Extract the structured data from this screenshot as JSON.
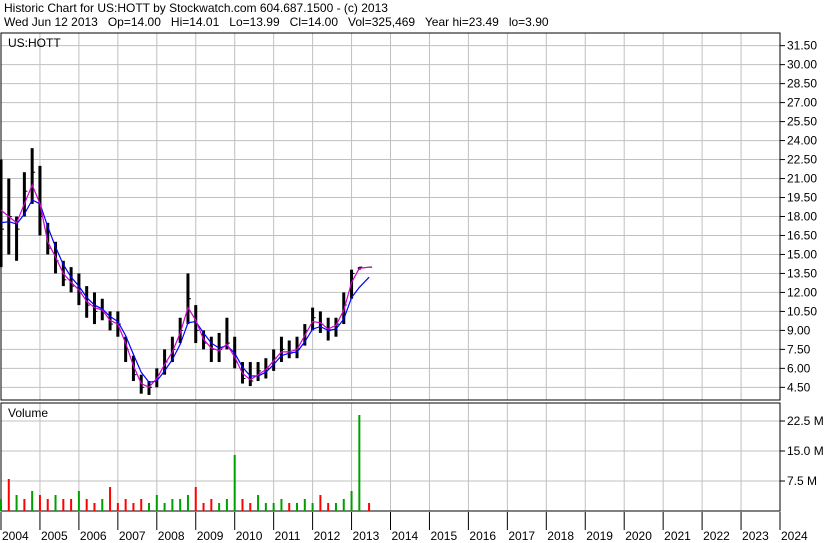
{
  "header": {
    "line1": "Historic Chart for US:HOTT by Stockwatch.com 604.687.1500 - (c) 2013",
    "line2": "Wed Jun 12 2013   Op=14.00   Hi=14.01   Lo=13.99   Cl=14.00   Vol=325,469   Year hi=23.49   lo=3.90"
  },
  "colors": {
    "price_bars": "#000000",
    "ma_short": "#d000d0",
    "ma_long": "#0000ff",
    "volume_up": "#00a000",
    "volume_down": "#ff0000",
    "grid": "#c0c0c0"
  },
  "chart_data": [
    {
      "type": "line",
      "panel_label": "US:HOTT",
      "ylim": [
        3.5,
        32.5
      ],
      "y_ticks": [
        "31.50",
        "30.00",
        "28.50",
        "27.00",
        "25.50",
        "24.00",
        "22.50",
        "21.00",
        "19.50",
        "18.00",
        "16.50",
        "15.00",
        "13.50",
        "12.00",
        "10.50",
        "9.00",
        "7.50",
        "6.00",
        "4.50"
      ],
      "y_tick_values": [
        31.5,
        30,
        28.5,
        27,
        25.5,
        24,
        22.5,
        21,
        19.5,
        18,
        16.5,
        15,
        13.5,
        12,
        10.5,
        9,
        7.5,
        6,
        4.5
      ],
      "x": [
        2004.0,
        2004.2,
        2004.4,
        2004.6,
        2004.8,
        2005.0,
        2005.2,
        2005.4,
        2005.6,
        2005.8,
        2006.0,
        2006.2,
        2006.4,
        2006.6,
        2006.8,
        2007.0,
        2007.2,
        2007.4,
        2007.6,
        2007.8,
        2008.0,
        2008.2,
        2008.4,
        2008.6,
        2008.8,
        2009.0,
        2009.2,
        2009.4,
        2009.6,
        2009.8,
        2010.0,
        2010.2,
        2010.4,
        2010.6,
        2010.8,
        2011.0,
        2011.2,
        2011.4,
        2011.6,
        2011.8,
        2012.0,
        2012.2,
        2012.4,
        2012.6,
        2012.8,
        2013.0,
        2013.2,
        2013.45
      ],
      "high": [
        22.5,
        21.0,
        18.0,
        21.5,
        23.4,
        22.0,
        17.5,
        16.0,
        14.5,
        14.0,
        13.5,
        12.5,
        12.0,
        11.5,
        10.5,
        10.5,
        8.5,
        7.0,
        5.5,
        5.0,
        6.0,
        7.5,
        8.5,
        10.0,
        13.5,
        11.0,
        9.0,
        8.5,
        8.8,
        10.0,
        8.5,
        6.5,
        6.5,
        6.5,
        6.8,
        7.5,
        8.5,
        8.2,
        8.5,
        9.5,
        10.8,
        10.5,
        10.0,
        10.0,
        12.0,
        13.8,
        14.0,
        14.0
      ],
      "low": [
        14.0,
        15.0,
        14.5,
        18.0,
        19.0,
        16.5,
        15.0,
        13.5,
        12.5,
        12.0,
        11.0,
        10.0,
        9.5,
        9.8,
        9.0,
        8.5,
        6.5,
        5.0,
        4.0,
        3.9,
        4.5,
        5.5,
        6.5,
        8.0,
        9.5,
        8.0,
        7.5,
        6.5,
        6.5,
        7.5,
        6.0,
        4.8,
        4.6,
        5.0,
        5.2,
        5.8,
        6.5,
        6.8,
        6.8,
        7.8,
        9.0,
        8.8,
        8.2,
        8.5,
        9.5,
        11.5,
        13.8,
        13.99
      ],
      "close": [
        17.0,
        18.0,
        17.0,
        20.0,
        21.5,
        18.0,
        15.5,
        14.5,
        13.0,
        12.5,
        12.0,
        11.0,
        10.5,
        10.5,
        9.5,
        9.5,
        7.5,
        5.5,
        4.5,
        4.5,
        5.5,
        6.5,
        7.5,
        9.0,
        11.5,
        9.0,
        8.0,
        7.5,
        7.5,
        8.0,
        6.5,
        5.2,
        5.0,
        5.8,
        6.0,
        6.8,
        7.5,
        7.2,
        7.5,
        9.0,
        10.0,
        9.5,
        9.0,
        9.5,
        11.0,
        13.5,
        14.0,
        14.0
      ],
      "ma_short": [
        18.5,
        18.0,
        17.5,
        19.0,
        20.5,
        19.0,
        16.0,
        14.8,
        13.5,
        12.8,
        12.2,
        11.3,
        10.8,
        10.6,
        9.8,
        9.5,
        8.0,
        6.2,
        4.8,
        4.5,
        5.2,
        6.3,
        7.3,
        8.8,
        10.8,
        9.8,
        8.3,
        7.6,
        7.4,
        7.9,
        6.9,
        5.6,
        5.1,
        5.5,
        5.9,
        6.6,
        7.3,
        7.3,
        7.5,
        8.6,
        9.7,
        9.6,
        9.1,
        9.4,
        10.6,
        12.8,
        13.9,
        14.0
      ],
      "ma_long": [
        17.5,
        17.6,
        17.4,
        18.2,
        19.3,
        19.0,
        17.2,
        15.6,
        14.2,
        13.2,
        12.5,
        11.6,
        11.0,
        10.7,
        10.1,
        9.7,
        8.6,
        7.1,
        5.7,
        4.9,
        5.0,
        5.8,
        6.7,
        7.9,
        9.6,
        9.7,
        8.8,
        8.0,
        7.6,
        7.8,
        7.2,
        6.1,
        5.4,
        5.4,
        5.7,
        6.3,
        7.0,
        7.2,
        7.3,
        8.1,
        9.1,
        9.3,
        9.0,
        9.1,
        9.9,
        11.6,
        12.4,
        13.2
      ]
    },
    {
      "type": "bar",
      "panel_label": "Volume",
      "ylim": [
        0,
        27
      ],
      "y_ticks": [
        "22.5 M",
        "15.0 M",
        "7.5 M"
      ],
      "y_tick_values": [
        22.5,
        15.0,
        7.5
      ],
      "x": [
        2004.0,
        2004.2,
        2004.4,
        2004.6,
        2004.8,
        2005.0,
        2005.2,
        2005.4,
        2005.6,
        2005.8,
        2006.0,
        2006.2,
        2006.4,
        2006.6,
        2006.8,
        2007.0,
        2007.2,
        2007.4,
        2007.6,
        2007.8,
        2008.0,
        2008.2,
        2008.4,
        2008.6,
        2008.8,
        2009.0,
        2009.2,
        2009.4,
        2009.6,
        2009.8,
        2010.0,
        2010.2,
        2010.4,
        2010.6,
        2010.8,
        2011.0,
        2011.2,
        2011.4,
        2011.6,
        2011.8,
        2012.0,
        2012.2,
        2012.4,
        2012.6,
        2012.8,
        2013.0,
        2013.2,
        2013.45
      ],
      "values": [
        3,
        8,
        4,
        3,
        5,
        4,
        3,
        4,
        3,
        3,
        5,
        3,
        2,
        3,
        6,
        2,
        3,
        2,
        3,
        2,
        4,
        2,
        3,
        3,
        4,
        6,
        2,
        3,
        2,
        3,
        14,
        3,
        2,
        4,
        2,
        2,
        3,
        2,
        2,
        3,
        2,
        4,
        2,
        2,
        3,
        5,
        24,
        2
      ],
      "up": [
        true,
        false,
        true,
        false,
        true,
        false,
        false,
        true,
        false,
        false,
        true,
        false,
        false,
        true,
        false,
        false,
        false,
        false,
        false,
        true,
        true,
        true,
        true,
        true,
        true,
        false,
        false,
        false,
        true,
        true,
        true,
        false,
        false,
        true,
        true,
        true,
        true,
        false,
        true,
        true,
        true,
        false,
        false,
        true,
        true,
        true,
        true,
        false
      ]
    }
  ],
  "x_axis": {
    "range": [
      2004,
      2024
    ],
    "labels": [
      "2004",
      "2005",
      "2006",
      "2007",
      "2008",
      "2009",
      "2010",
      "2011",
      "2012",
      "2013",
      "2014",
      "2015",
      "2016",
      "2017",
      "2018",
      "2019",
      "2020",
      "2021",
      "2022",
      "2023",
      "2024"
    ]
  }
}
